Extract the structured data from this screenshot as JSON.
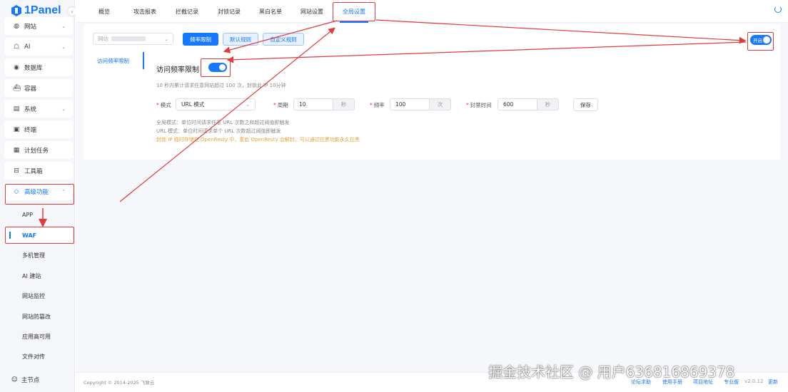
{
  "app": {
    "logo_text": "1Panel",
    "collapse_icon": "chevron-left-icon"
  },
  "sidebar": {
    "items": [
      {
        "label": "网站",
        "icon": "globe-icon",
        "chevron": "⌄"
      },
      {
        "label": "AI",
        "icon": "robot-icon",
        "chevron": "⌄"
      },
      {
        "label": "数据库",
        "icon": "database-icon",
        "chevron": ""
      },
      {
        "label": "容器",
        "icon": "container-icon",
        "chevron": ""
      },
      {
        "label": "系统",
        "icon": "system-icon",
        "chevron": "⌄"
      },
      {
        "label": "终端",
        "icon": "terminal-icon",
        "chevron": ""
      },
      {
        "label": "计划任务",
        "icon": "calendar-icon",
        "chevron": ""
      },
      {
        "label": "工具箱",
        "icon": "toolbox-icon",
        "chevron": ""
      },
      {
        "label": "高级功能",
        "icon": "diamond-icon",
        "chevron": "⌃"
      }
    ],
    "submenu": [
      "APP",
      "WAF",
      "多机管理",
      "AI 建站",
      "网站监控",
      "网站防篡改",
      "应用高可用",
      "文件对传"
    ],
    "active_sub": "WAF",
    "node_label": "主节点"
  },
  "tabs": [
    "概览",
    "攻击报表",
    "拦截记录",
    "封锁记录",
    "黑白名单",
    "网站设置",
    "全局设置"
  ],
  "active_tab": "全局设置",
  "toolbar": {
    "site_select_prefix": "网站",
    "buttons": [
      "频率限制",
      "默认规则",
      "自定义规则"
    ],
    "global_toggle_label": "开启"
  },
  "left_tab": "访问频率限制",
  "section": {
    "title": "访问频率限制",
    "description": "10 秒内累计请求任意网站超过 100 次，封锁此 IP 10分钟"
  },
  "form": {
    "mode_label": "模式",
    "mode_value": "URL 模式",
    "period_label": "周期",
    "period_value": "10",
    "period_unit": "秒",
    "rate_label": "频率",
    "rate_value": "100",
    "rate_unit": "次",
    "ban_label": "封禁时间",
    "ban_value": "600",
    "ban_unit": "秒",
    "save_label": "保存"
  },
  "notes": {
    "global_mode": "全局模式：单位时间请求任意 URL 次数之和超过阈值即触发",
    "url_mode": "URL 模式：单位时间请求单个 URL 次数超过阈值即触发",
    "warning": "封锁 IP 临时存储在 OpenResty 中，重启 OpenResty 会解封，可以通过拉黑功能永久拉黑"
  },
  "footer": {
    "copyright": "Copyright © 2014-2025 飞致云",
    "links": [
      "论坛求助",
      "使用手册",
      "项目地址",
      "专业版"
    ],
    "version": "v2.0.12",
    "update": "更新"
  },
  "watermark": "掘金技术社区 @ 用户636816869378",
  "colors": {
    "accent": "#1677ff",
    "annotation": "#e03c3c",
    "warning": "#e6a23c"
  }
}
